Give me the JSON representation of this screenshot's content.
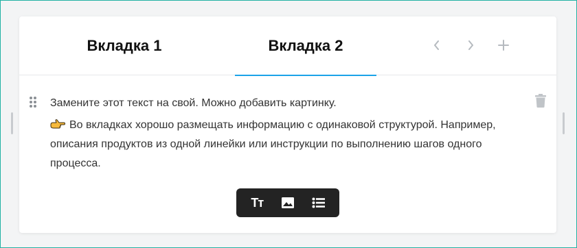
{
  "tabs": [
    {
      "label": "Вкладка 1",
      "active": false
    },
    {
      "label": "Вкладка 2",
      "active": true
    }
  ],
  "nav": {
    "prev_icon": "chevron-left-icon",
    "next_icon": "chevron-right-icon",
    "add_icon": "plus-icon"
  },
  "content": {
    "paragraph_1": "Замените этот текст на свой. Можно добавить картинку.",
    "paragraph_2": "Во вкладках хорошо размещать информацию с одинаковой структурой. Например, описания продуктов из одной линейки или инструкции по выполнению шагов одного процесса.",
    "hand_icon": "pointing-hand-icon"
  },
  "toolbar": {
    "text_label": "Тт",
    "image_icon": "image-icon",
    "list_icon": "list-icon"
  },
  "colors": {
    "accent": "#1aa3e8",
    "frame_border": "#20b2a4",
    "toolbar_bg": "#232323",
    "icon_gray": "#c0c4c8"
  }
}
